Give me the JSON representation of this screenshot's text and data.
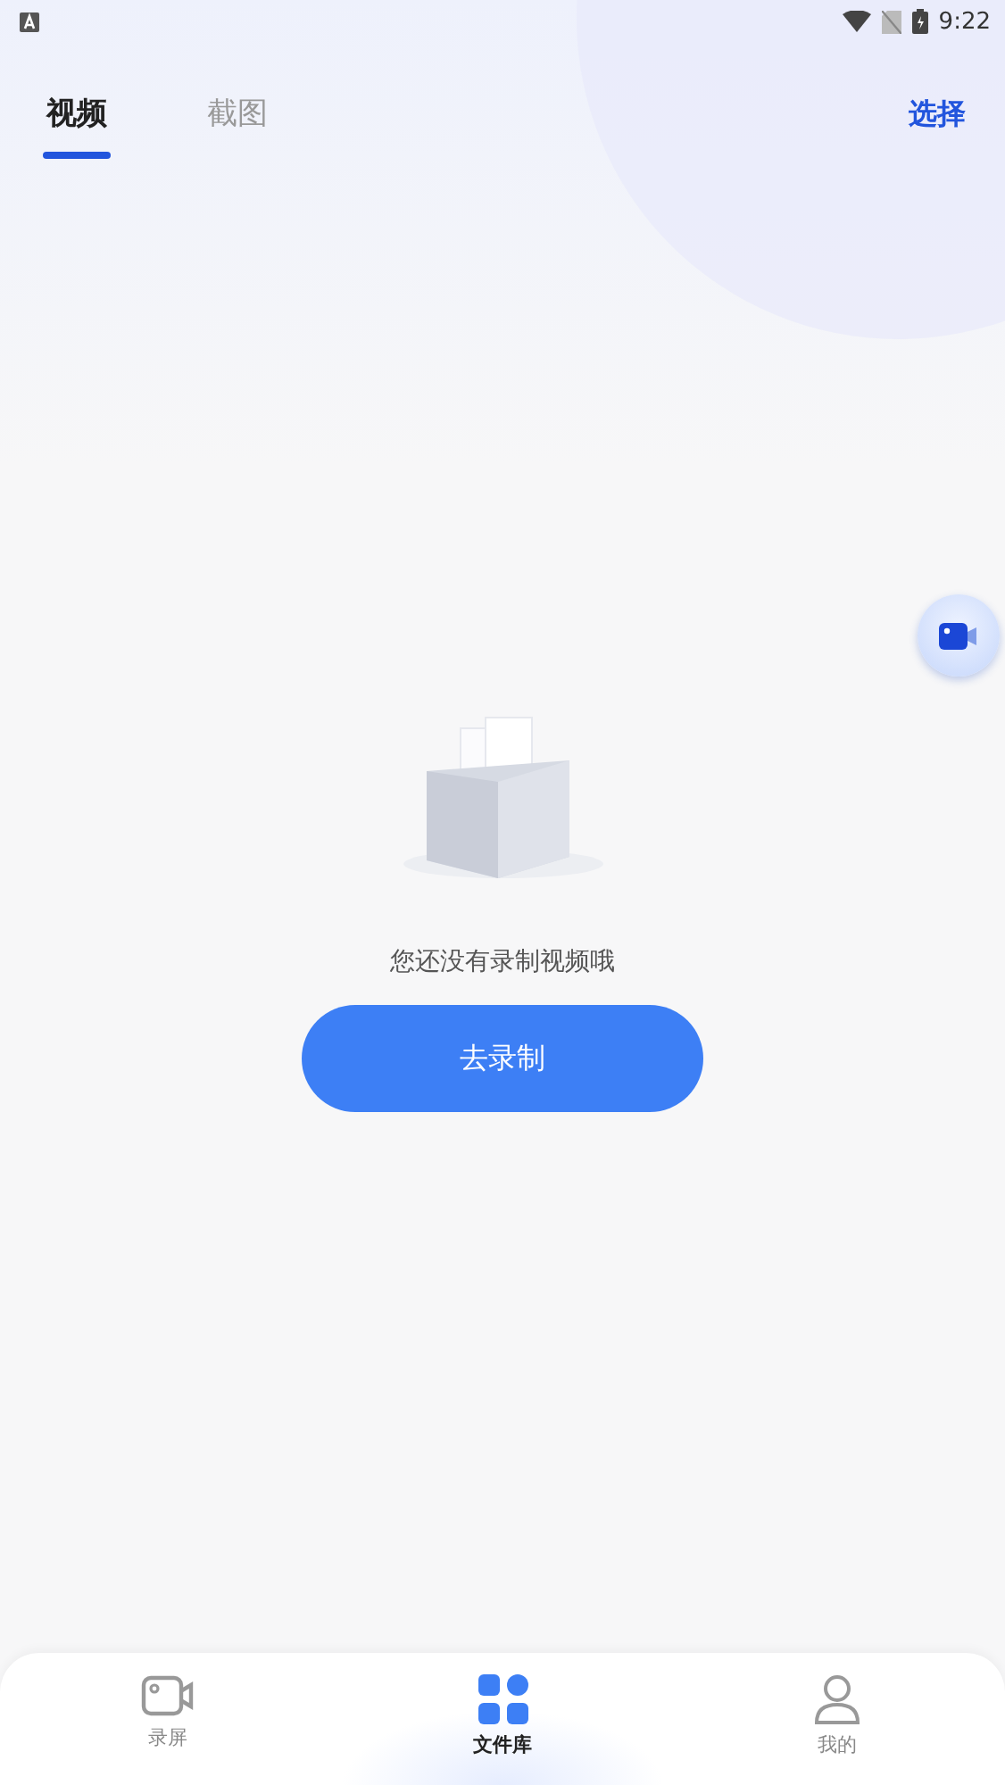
{
  "status_bar": {
    "time": "9:22"
  },
  "tabs": [
    {
      "label": "视频",
      "selected": true
    },
    {
      "label": "截图",
      "selected": false
    }
  ],
  "select_action": "选择",
  "empty_state": {
    "message": "您还没有录制视频哦",
    "button": "去录制"
  },
  "bottom_nav": [
    {
      "label": "录屏",
      "kind": "record",
      "selected": false
    },
    {
      "label": "文件库",
      "kind": "library",
      "selected": true
    },
    {
      "label": "我的",
      "kind": "profile",
      "selected": false
    }
  ]
}
